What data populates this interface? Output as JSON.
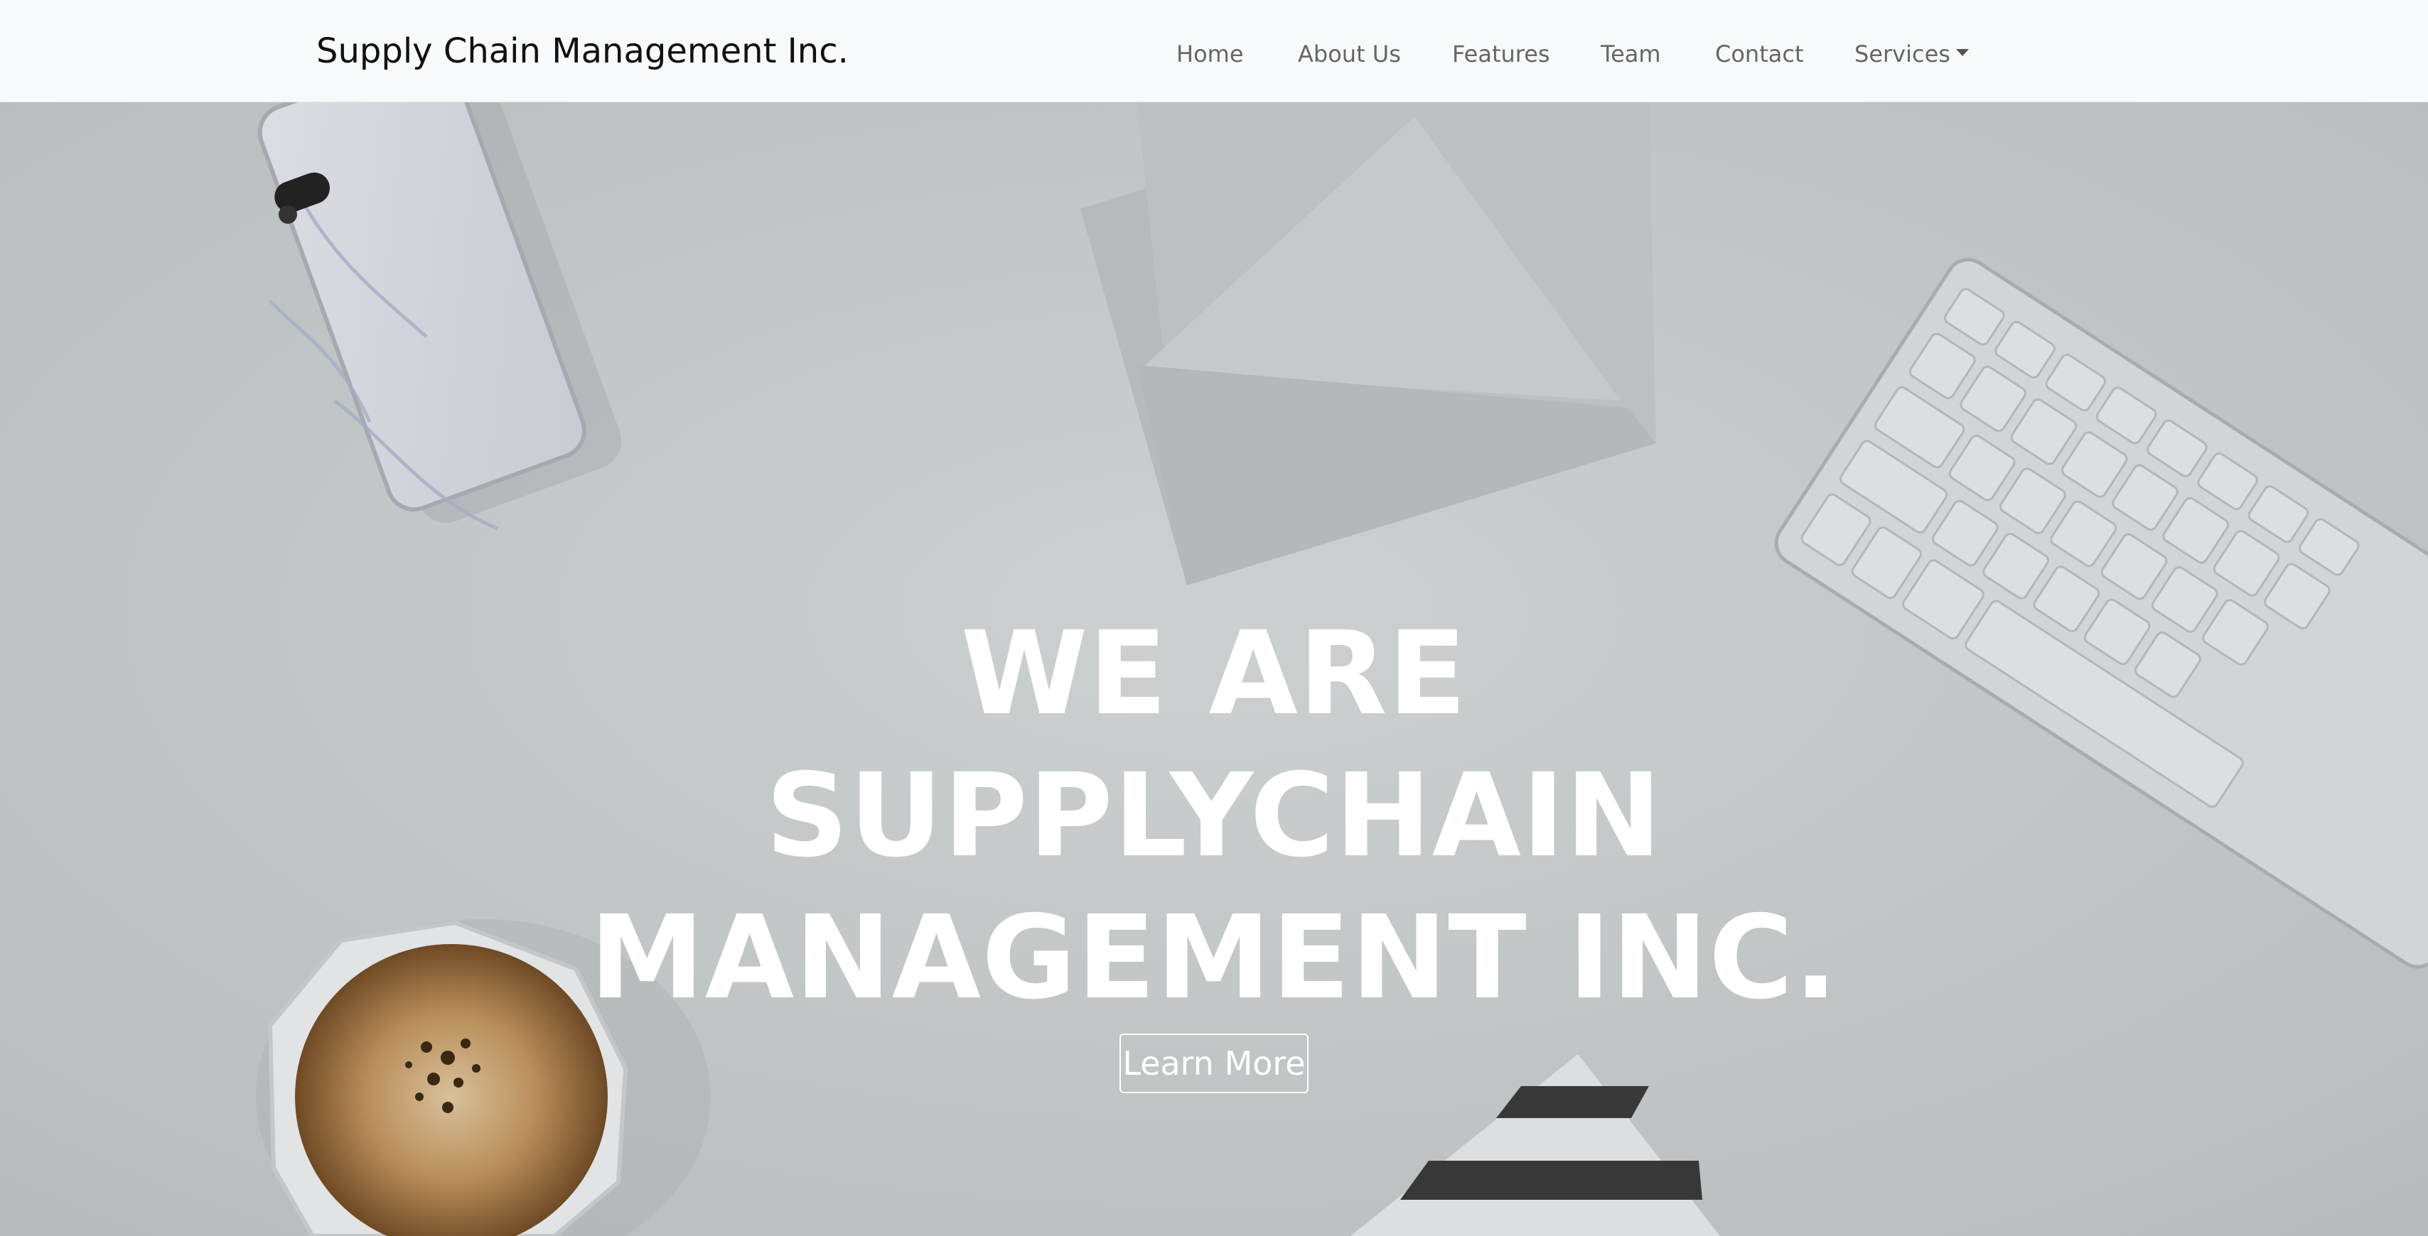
{
  "navbar": {
    "brand": "Supply Chain Management Inc.",
    "links": [
      {
        "label": "Home"
      },
      {
        "label": "About Us"
      },
      {
        "label": "Features"
      },
      {
        "label": "Team"
      },
      {
        "label": "Contact"
      },
      {
        "label": "Services",
        "icon": "caret-down-icon"
      }
    ]
  },
  "hero": {
    "title_lines": [
      "WE ARE",
      "SUPPLYCHAIN",
      "MANAGEMENT INC."
    ],
    "cta_label": "Learn More"
  },
  "colors": {
    "navbar_bg": "#f8f9fa",
    "hero_overlay": "#c3c6c7",
    "hero_text": "#ffffff",
    "nav_text": "#666666"
  }
}
